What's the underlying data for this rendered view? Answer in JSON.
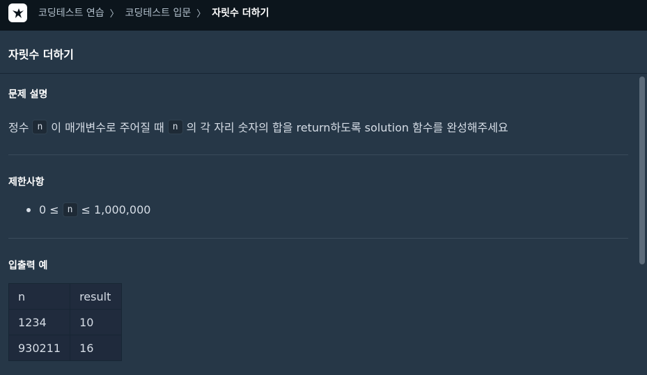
{
  "breadcrumb": {
    "items": [
      "코딩테스트 연습",
      "코딩테스트 입문",
      "자릿수 더하기"
    ],
    "separator": "〉"
  },
  "problem_title": "자릿수 더하기",
  "sections": {
    "description": {
      "title": "문제 설명",
      "text_before": "정수",
      "code1": "n",
      "text_middle": "이 매개변수로 주어질 때",
      "code2": "n",
      "text_after": "의 각 자리 숫자의 합을 return하도록 solution 함수를 완성해주세요"
    },
    "constraints": {
      "title": "제한사항",
      "item_prefix": "0 ≤",
      "item_code": "n",
      "item_suffix": "≤ 1,000,000"
    },
    "examples": {
      "title": "입출력 예",
      "headers": [
        "n",
        "result"
      ],
      "rows": [
        [
          "1234",
          "10"
        ],
        [
          "930211",
          "16"
        ]
      ]
    }
  },
  "colors": {
    "topbar_bg": "#0c151c",
    "page_bg": "#263747",
    "table_bg": "#202b3d",
    "text": "#d6dde6"
  },
  "icons": {
    "logo": "programmers-logo-icon"
  }
}
